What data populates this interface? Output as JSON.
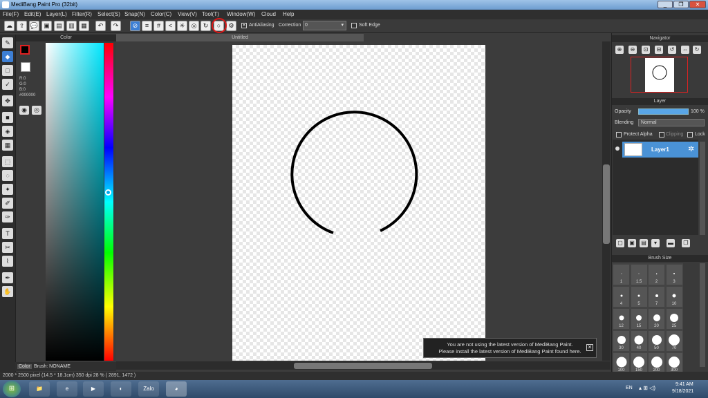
{
  "window": {
    "title": "MediBang Paint Pro (32bit)",
    "minimize": "_",
    "restore": "❐",
    "close": "✕"
  },
  "menu": [
    "File(F)",
    "Edit(E)",
    "Layer(L)",
    "Filter(R)",
    "Select(S)",
    "Snap(N)",
    "Color(C)",
    "View(V)",
    "Tool(T)",
    "Window(W)",
    "Cloud",
    "Help"
  ],
  "toolbar": {
    "antialiasing_label": "AntiAliasing",
    "correction_label": "Correction",
    "correction_value": "0",
    "softedge_label": "Soft Edge"
  },
  "color_panel": {
    "title": "Color",
    "r": "R:0",
    "g": "G:0",
    "b": "B:0",
    "hex": "#000000",
    "tab_color": "Color",
    "tab_brush": "Brush: NONAME",
    "fg_color": "#000000",
    "accent": "#e02020"
  },
  "document": {
    "tab_title": "Untitled"
  },
  "status": {
    "text": "2000 * 2500 pixel  (14.5 * 18.1cm)  350 dpi  28 %  ( 2891, 1472 )"
  },
  "navigator": {
    "title": "Navigator"
  },
  "layer_panel": {
    "title": "Layer",
    "opacity_label": "Opacity",
    "opacity_value": "100 %",
    "blending_label": "Blending",
    "blending_value": "Normal",
    "protect_alpha": "Protect Alpha",
    "clipping": "Clipping",
    "lock": "Lock",
    "layer_name": "Layer1"
  },
  "brush_panel": {
    "title": "Brush Size",
    "sizes": [
      "1",
      "1.5",
      "2",
      "3",
      "4",
      "5",
      "7",
      "10",
      "12",
      "15",
      "20",
      "25",
      "30",
      "40",
      "50",
      "70",
      "100",
      "150",
      "200",
      "300"
    ]
  },
  "notification": {
    "line1": "You are not using the latest version of MediBang Paint.",
    "line2": "Please install the latest version of MediBang Paint found here."
  },
  "taskbar": {
    "lang": "EN",
    "time": "9:41 AM",
    "date": "9/18/2021",
    "zalo": "Zalo"
  }
}
